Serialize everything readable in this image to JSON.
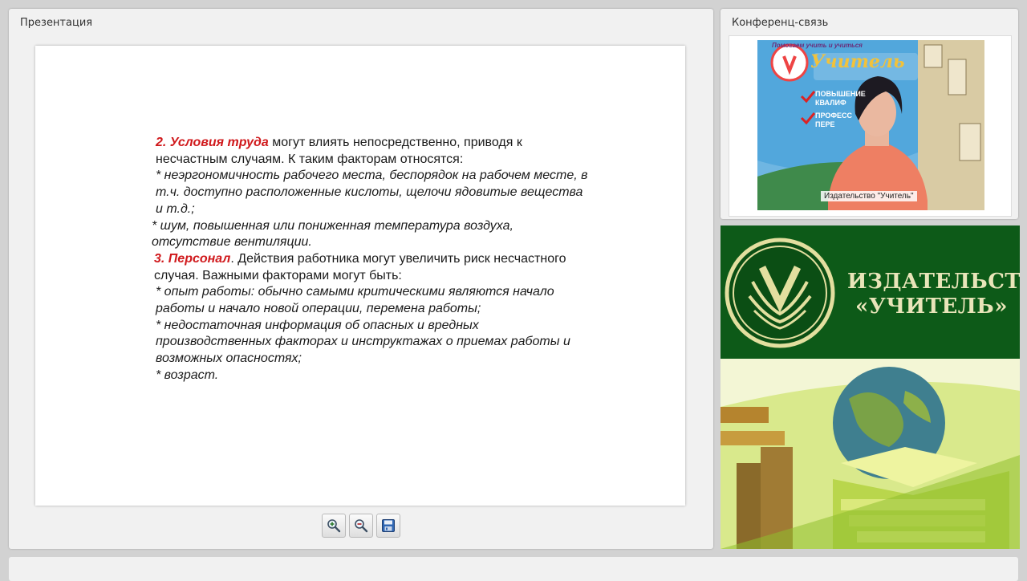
{
  "presentation": {
    "title": "Презентация",
    "slide": {
      "p1_heading": "2. Условия труда",
      "p1_text": " могут влиять непосредственно, приводя к несчастным случаям. К таким факторам относятся:",
      "item1": "* неэргономичность рабочего места, беспорядок на рабочем месте, в т.ч. доступно расположенные кислоты, щелочи ядовитые вещества и т.д.;",
      "item2": "* шум, повышенная или пониженная температура воздуха, отсутствие вентиляции.",
      "p2_heading": "3. Персонал",
      "p2_text": ". Действия работника могут увеличить риск несчастного случая. Важными факторами могут быть:",
      "item3": "* опыт работы: обычно самыми критическими являются начало работы и начало новой операции, перемена работы;",
      "item4": "* недостаточная информация об опасных и вредных производственных факторах и инструктажах о приемах работы и возможных опасностях;",
      "item5": "* возраст."
    },
    "toolbar": {
      "zoom_in_icon": "zoom-in-icon",
      "zoom_out_icon": "zoom-out-icon",
      "save_icon": "save-icon"
    }
  },
  "conference": {
    "title": "Конференц-связь",
    "video_label": "Издательство \"Учитель\"",
    "banner_slogan": "Помогаем учить и учиться",
    "banner_logo_text": "Учитель",
    "banner_line1": "ПОВЫШЕНИЕ КВАЛИФ",
    "banner_line2": "ПРОФЕСС ПЕРЕ"
  },
  "brand": {
    "line1": "ИЗДАТЕЛЬСТВО",
    "line2": "«УЧИТЕЛЬ»"
  },
  "colors": {
    "accent_red": "#d0191c",
    "brand_green": "#0d5a18",
    "brand_text": "#e9e5b9"
  }
}
